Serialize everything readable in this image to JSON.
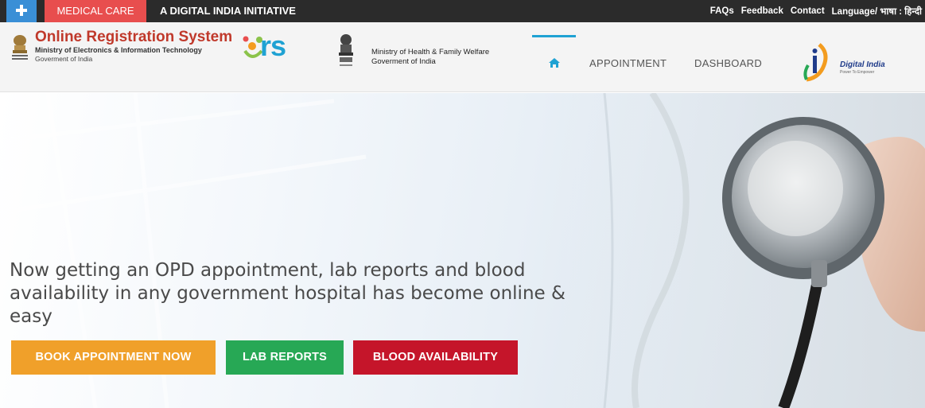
{
  "topbar": {
    "medical_care": "MEDICAL CARE",
    "initiative": "A DIGITAL INDIA INITIATIVE",
    "links": [
      "FAQs",
      "Feedback",
      "Contact",
      "Language/ भाषा : हिन्दी"
    ]
  },
  "header": {
    "ors_title": "Online Registration System",
    "ors_subtitle1": "Ministry of Electronics & Information Technology",
    "ors_subtitle2": "Goverment of India",
    "ors_logo_text": "rs",
    "ministry_line1": "Ministry of Health & Family Welfare",
    "ministry_line2": "Goverment of India",
    "nav": {
      "appointment": "APPOINTMENT",
      "dashboard": "DASHBOARD"
    },
    "digital_india": "Digital India",
    "digital_india_tagline": "Power To Empower"
  },
  "hero": {
    "headline": "Now getting an OPD appointment, lab reports and blood availability in any government hospital has become online & easy",
    "buttons": {
      "book": "BOOK APPOINTMENT NOW",
      "lab": "LAB REPORTS",
      "blood": "BLOOD AVAILABILITY"
    }
  },
  "colors": {
    "topbar": "#2b2b2b",
    "plus_box": "#3a8fd6",
    "medical_care": "#e84e4e",
    "ors_title": "#c0392b",
    "accent": "#1fa2d3",
    "book_button": "#f0a02a",
    "lab_button": "#27a855",
    "blood_button": "#c5152a"
  },
  "icons": {
    "plus": "plus-icon",
    "home": "home-icon",
    "emblem": "national-emblem-icon",
    "digital_india": "digital-india-logo"
  }
}
